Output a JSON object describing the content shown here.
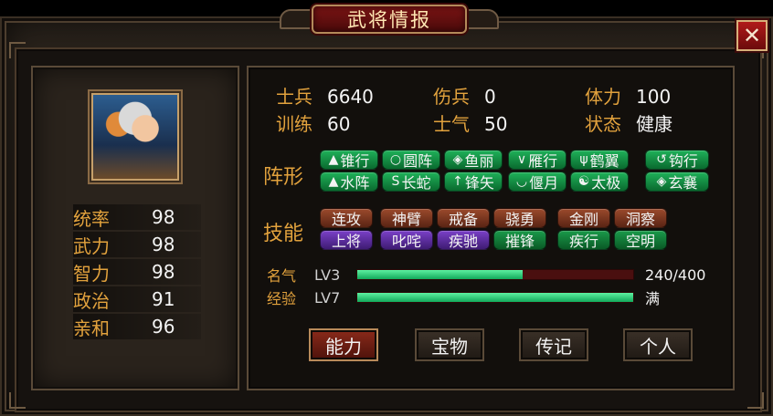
{
  "title": "武将情报",
  "close_icon": "✕",
  "base_stats": [
    {
      "label": "统率",
      "value": "98"
    },
    {
      "label": "武力",
      "value": "98"
    },
    {
      "label": "智力",
      "value": "98"
    },
    {
      "label": "政治",
      "value": "91"
    },
    {
      "label": "亲和",
      "value": "96"
    }
  ],
  "top_stats": [
    {
      "label": "士兵",
      "value": "6640"
    },
    {
      "label": "伤兵",
      "value": "0"
    },
    {
      "label": "体力",
      "value": "100"
    },
    {
      "label": "训练",
      "value": "60"
    },
    {
      "label": "士气",
      "value": "50"
    },
    {
      "label": "状态",
      "value": "健康"
    }
  ],
  "formation": {
    "label": "阵形",
    "items": [
      {
        "icon": "▲",
        "name": "锥行"
      },
      {
        "icon": "○",
        "name": "圆阵"
      },
      {
        "icon": "◈",
        "name": "鱼丽"
      },
      {
        "icon": "∨",
        "name": "雁行"
      },
      {
        "icon": "ψ",
        "name": "鹤翼"
      },
      {
        "icon": "↺",
        "name": "钩行"
      },
      {
        "icon": "▲",
        "name": "水阵"
      },
      {
        "icon": "S",
        "name": "长蛇"
      },
      {
        "icon": "↑",
        "name": "锋矢"
      },
      {
        "icon": "◡",
        "name": "偃月"
      },
      {
        "icon": "☯",
        "name": "太极"
      },
      {
        "icon": "◈",
        "name": "玄襄"
      }
    ]
  },
  "skills": {
    "label": "技能",
    "row1": [
      "连攻",
      "神臂",
      "戒备",
      "骁勇",
      "金刚",
      "洞察"
    ],
    "row2": [
      {
        "name": "上将",
        "color": "purple"
      },
      {
        "name": "叱咤",
        "color": "purple"
      },
      {
        "name": "疾驰",
        "color": "purple"
      },
      {
        "name": "摧锋",
        "color": "green"
      },
      {
        "name": "疾行",
        "color": "green"
      },
      {
        "name": "空明",
        "color": "green"
      }
    ]
  },
  "fame": {
    "label": "名气",
    "level": "LV3",
    "text": "240/400",
    "progress": 0.6
  },
  "exp": {
    "label": "经验",
    "level": "LV7",
    "text": "满",
    "progress": 1.0
  },
  "tabs": [
    {
      "label": "能力",
      "active": true
    },
    {
      "label": "宝物",
      "active": false
    },
    {
      "label": "传记",
      "active": false
    },
    {
      "label": "个人",
      "active": false
    }
  ]
}
